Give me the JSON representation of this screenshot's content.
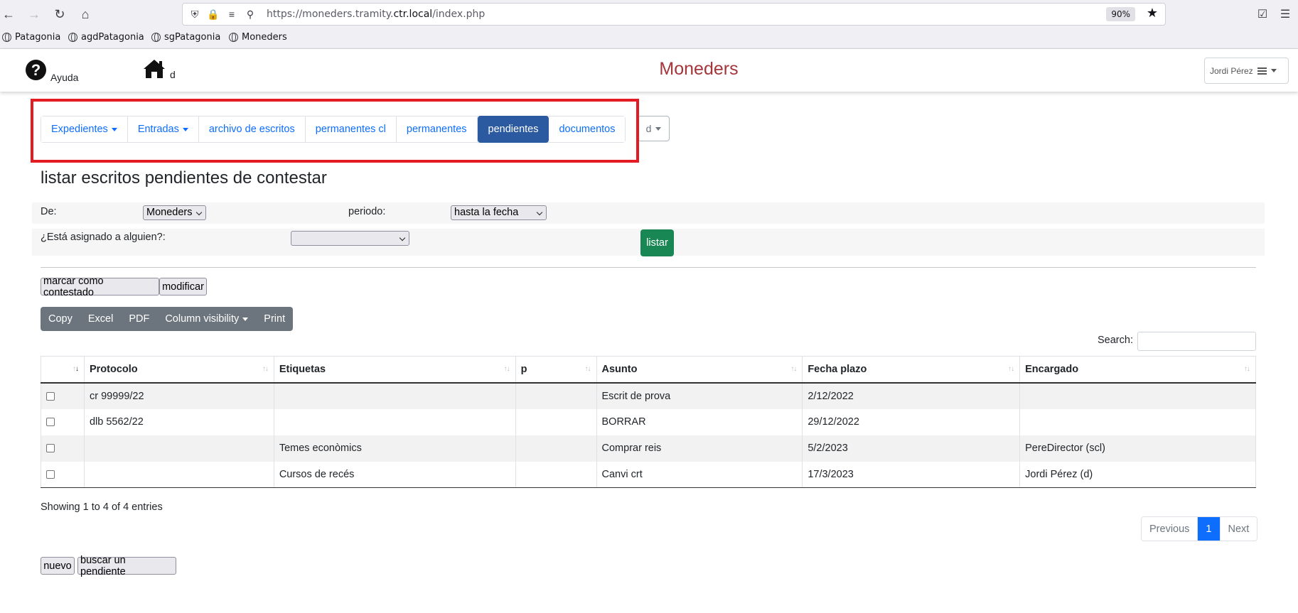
{
  "browser": {
    "url_prefix": "https://moneders.tramity.",
    "url_domain": "ctr.local",
    "url_suffix": "/index.php",
    "zoom": "90%",
    "bookmarks": [
      "Patagonia",
      "agdPatagonia",
      "sgPatagonia",
      "Moneders"
    ]
  },
  "header": {
    "help_label": "Ayuda",
    "home_label": "d",
    "title": "Moneders",
    "user": "Jordi Pérez"
  },
  "menu": {
    "items": [
      "Expedientes",
      "Entradas",
      "archivo de escritos",
      "permanentes cl",
      "permanentes",
      "pendientes",
      "documentos"
    ],
    "active": "pendientes",
    "extra": "d"
  },
  "page": {
    "title": "listar escritos pendientes de contestar"
  },
  "filters": {
    "de_label": "De:",
    "de_value": "Moneders",
    "periodo_label": "periodo:",
    "periodo_value": "hasta la fecha",
    "asignado_label": "¿Está asignado a alguien?:",
    "asignado_value": "",
    "listar_button": "listar"
  },
  "actions": {
    "marcar": "marcar como contestado",
    "modificar": "modificar",
    "nuevo": "nuevo",
    "buscar": "buscar un pendiente"
  },
  "dt_buttons": [
    "Copy",
    "Excel",
    "PDF",
    "Column visibility",
    "Print"
  ],
  "search_label": "Search:",
  "table": {
    "columns": [
      "",
      "Protocolo",
      "Etiquetas",
      "p",
      "Asunto",
      "Fecha plazo",
      "Encargado"
    ],
    "rows": [
      [
        "",
        "cr 99999/22",
        "",
        "",
        "Escrit de prova",
        "2/12/2022",
        ""
      ],
      [
        "",
        "dlb 5562/22",
        "",
        "",
        "BORRAR",
        "29/12/2022",
        ""
      ],
      [
        "",
        "",
        "Temes econòmics",
        "",
        "Comprar reis",
        "5/2/2023",
        "PereDirector (scl)"
      ],
      [
        "",
        "",
        "Cursos de recés",
        "",
        "Canvi crt",
        "17/3/2023",
        "Jordi Pérez (d)"
      ]
    ]
  },
  "footer": {
    "info": "Showing 1 to 4 of 4 entries",
    "prev": "Previous",
    "page": "1",
    "next": "Next"
  },
  "colors": {
    "title": "#a4353a",
    "active_tab": "#2c5aa0",
    "listar": "#198754",
    "highlight": "#e31b23"
  }
}
